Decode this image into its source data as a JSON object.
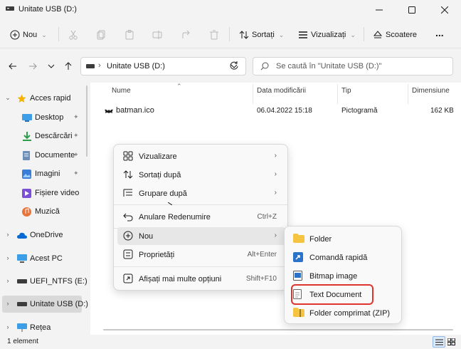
{
  "window": {
    "title": "Unitate USB (D:)",
    "controls": [
      "minimize-icon",
      "maximize-icon",
      "close-icon"
    ]
  },
  "toolbar": {
    "new_label": "Nou",
    "sort_label": "Sortați",
    "view_label": "Vizualizați",
    "eject_label": "Scoatere",
    "more_label": "..."
  },
  "address": {
    "path": "Unitate USB (D:)",
    "search_placeholder": "Se caută în \"Unitate USB (D:)\""
  },
  "nav": {
    "items": [
      {
        "label": "Acces rapid",
        "icon": "star-icon"
      },
      {
        "label": "Desktop",
        "icon": "desktop-icon",
        "pinned": true
      },
      {
        "label": "Descărcări",
        "icon": "download-icon",
        "pinned": true
      },
      {
        "label": "Documente",
        "icon": "documents-icon",
        "pinned": true
      },
      {
        "label": "Imagini",
        "icon": "pictures-icon",
        "pinned": true
      },
      {
        "label": "Fișiere video",
        "icon": "videos-icon"
      },
      {
        "label": "Muzică",
        "icon": "music-icon"
      },
      {
        "label": "OneDrive",
        "icon": "cloud-icon"
      },
      {
        "label": "Acest PC",
        "icon": "pc-icon"
      },
      {
        "label": "UEFI_NTFS (E:)",
        "icon": "drive-icon"
      },
      {
        "label": "Unitate USB (D:)",
        "icon": "drive-icon",
        "selected": true
      },
      {
        "label": "Rețea",
        "icon": "network-icon"
      }
    ]
  },
  "columns": {
    "name": "Nume",
    "modified": "Data modificării",
    "type": "Tip",
    "size": "Dimensiune"
  },
  "files": [
    {
      "name": "batman.ico",
      "modified": "06.04.2022 15:18",
      "type": "Pictogramă",
      "size": "162 KB"
    }
  ],
  "context_menu": {
    "items": [
      {
        "label": "Vizualizare",
        "icon": "grid-icon",
        "arrow": true
      },
      {
        "label": "Sortați după",
        "icon": "sort-icon",
        "arrow": true
      },
      {
        "label": "Grupare după",
        "icon": "group-icon",
        "arrow": true
      },
      {
        "label": "Anulare Redenumire",
        "icon": "undo-icon",
        "shortcut": "Ctrl+Z"
      },
      {
        "label": "Nou",
        "icon": "plus-circle-icon",
        "arrow": true,
        "highlighted": true
      },
      {
        "label": "Proprietăți",
        "icon": "properties-icon",
        "shortcut": "Alt+Enter"
      },
      {
        "label": "Afișați mai multe opțiuni",
        "icon": "more-options-icon",
        "shortcut": "Shift+F10"
      }
    ]
  },
  "new_submenu": {
    "items": [
      {
        "label": "Folder",
        "icon": "folder-icon"
      },
      {
        "label": "Comandă rapidă",
        "icon": "shortcut-icon"
      },
      {
        "label": "Bitmap image",
        "icon": "bitmap-icon"
      },
      {
        "label": "Text Document",
        "icon": "text-document-icon",
        "highlighted": true
      },
      {
        "label": "Folder comprimat (ZIP)",
        "icon": "zip-folder-icon"
      }
    ]
  },
  "status": {
    "count": "1 element"
  },
  "colors": {
    "accent": "#0067c0",
    "highlight_border": "#e0332e",
    "folder": "#f5c542"
  }
}
